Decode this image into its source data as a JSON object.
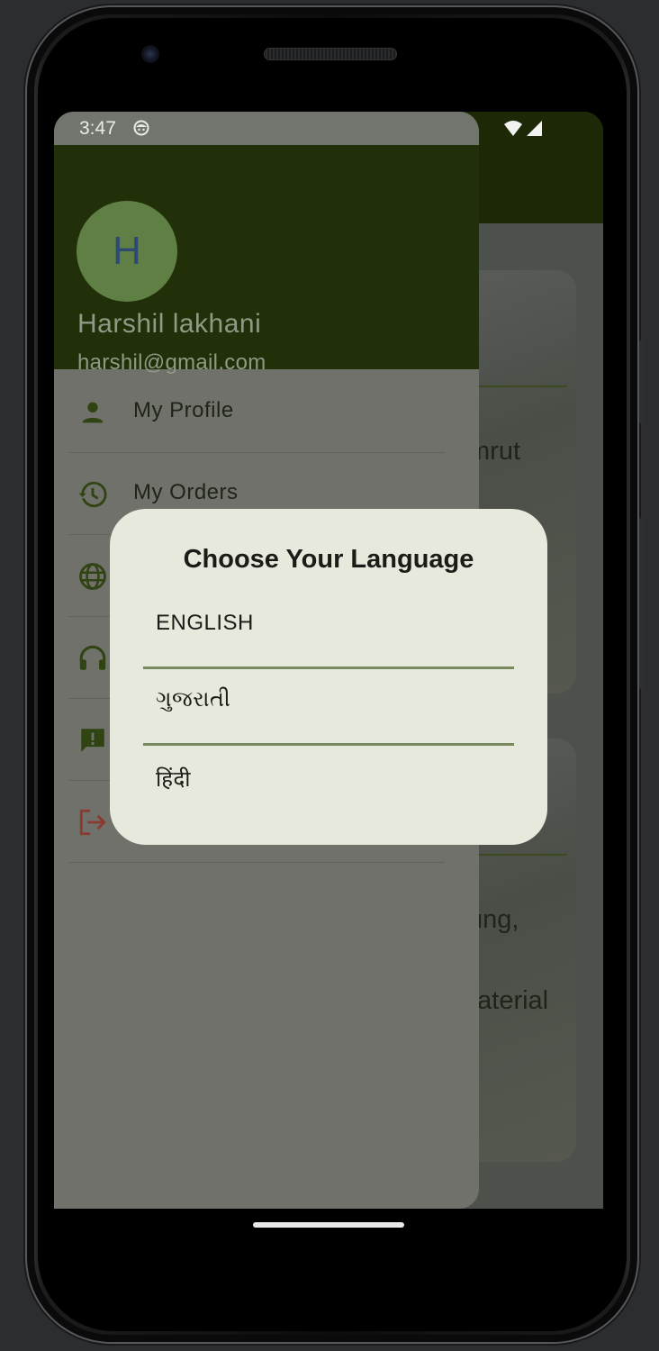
{
  "status_bar": {
    "time": "3:47"
  },
  "background_app": {
    "card1_text": "mrut",
    "card2_text_a": "ung,",
    "card2_text_b": "naterial"
  },
  "drawer": {
    "avatar_letter": "H",
    "user_name": "Harshil lakhani",
    "user_email": "harshil@gmail.com",
    "menu": [
      {
        "label": "My Profile",
        "icon": "person-icon"
      },
      {
        "label": "My Orders",
        "icon": "history-icon"
      },
      {
        "label": "",
        "icon": "globe-icon"
      },
      {
        "label": "",
        "icon": "headset-icon"
      },
      {
        "label": "",
        "icon": "feedback-icon"
      },
      {
        "label": "",
        "icon": "logout-icon"
      }
    ]
  },
  "dialog": {
    "title": "Choose Your Language",
    "options": [
      "ENGLISH",
      "ગુજરાતી",
      "हिंदी"
    ]
  },
  "colors": {
    "drawer_header": "#213008",
    "accent_green": "#788a5f",
    "dialog_bg": "#e6e9dc",
    "logout_red": "#8a3a2e"
  }
}
